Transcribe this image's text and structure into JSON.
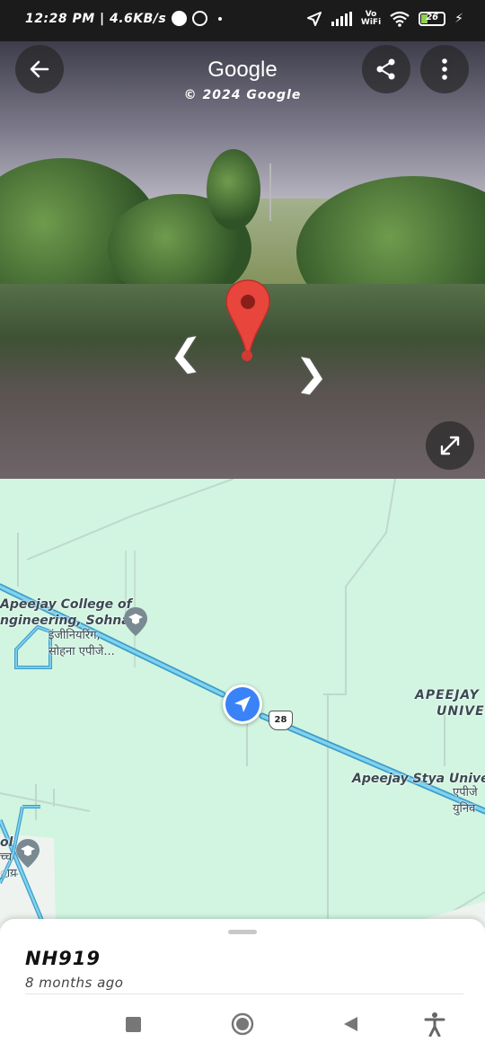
{
  "status_bar": {
    "time_speed": "12:28 PM | 4.6KB/s",
    "battery": "26",
    "network_label_top": "Vo",
    "network_label_bottom": "WiFi"
  },
  "street_view": {
    "title": "Google",
    "copyright": "© 2024 Google"
  },
  "map": {
    "places": [
      {
        "name_line1": "Apeejay College of",
        "name_line2": "ngineering, Sohna",
        "local_line1": "इंजीनियरिंग,",
        "local_line2": "सोहना एपीजे..."
      },
      {
        "name_line1": "APEEJAY S",
        "name_line2": "UNIVER"
      },
      {
        "name_line1": "Apeejay Stya Univers",
        "local_line1": "एपीजे",
        "local_line2": "युनिव"
      },
      {
        "name_line1": "ol",
        "local_line1": "च्च",
        "local_line2": "ाय"
      }
    ],
    "road_shield": "28"
  },
  "sheet": {
    "road_name": "NH919",
    "captured": "8 months ago"
  },
  "colors": {
    "map_bg": "#d1f5e0",
    "road": "#4fb3d9",
    "location_blue": "#3a82f7",
    "pin_red": "#e8453c"
  }
}
